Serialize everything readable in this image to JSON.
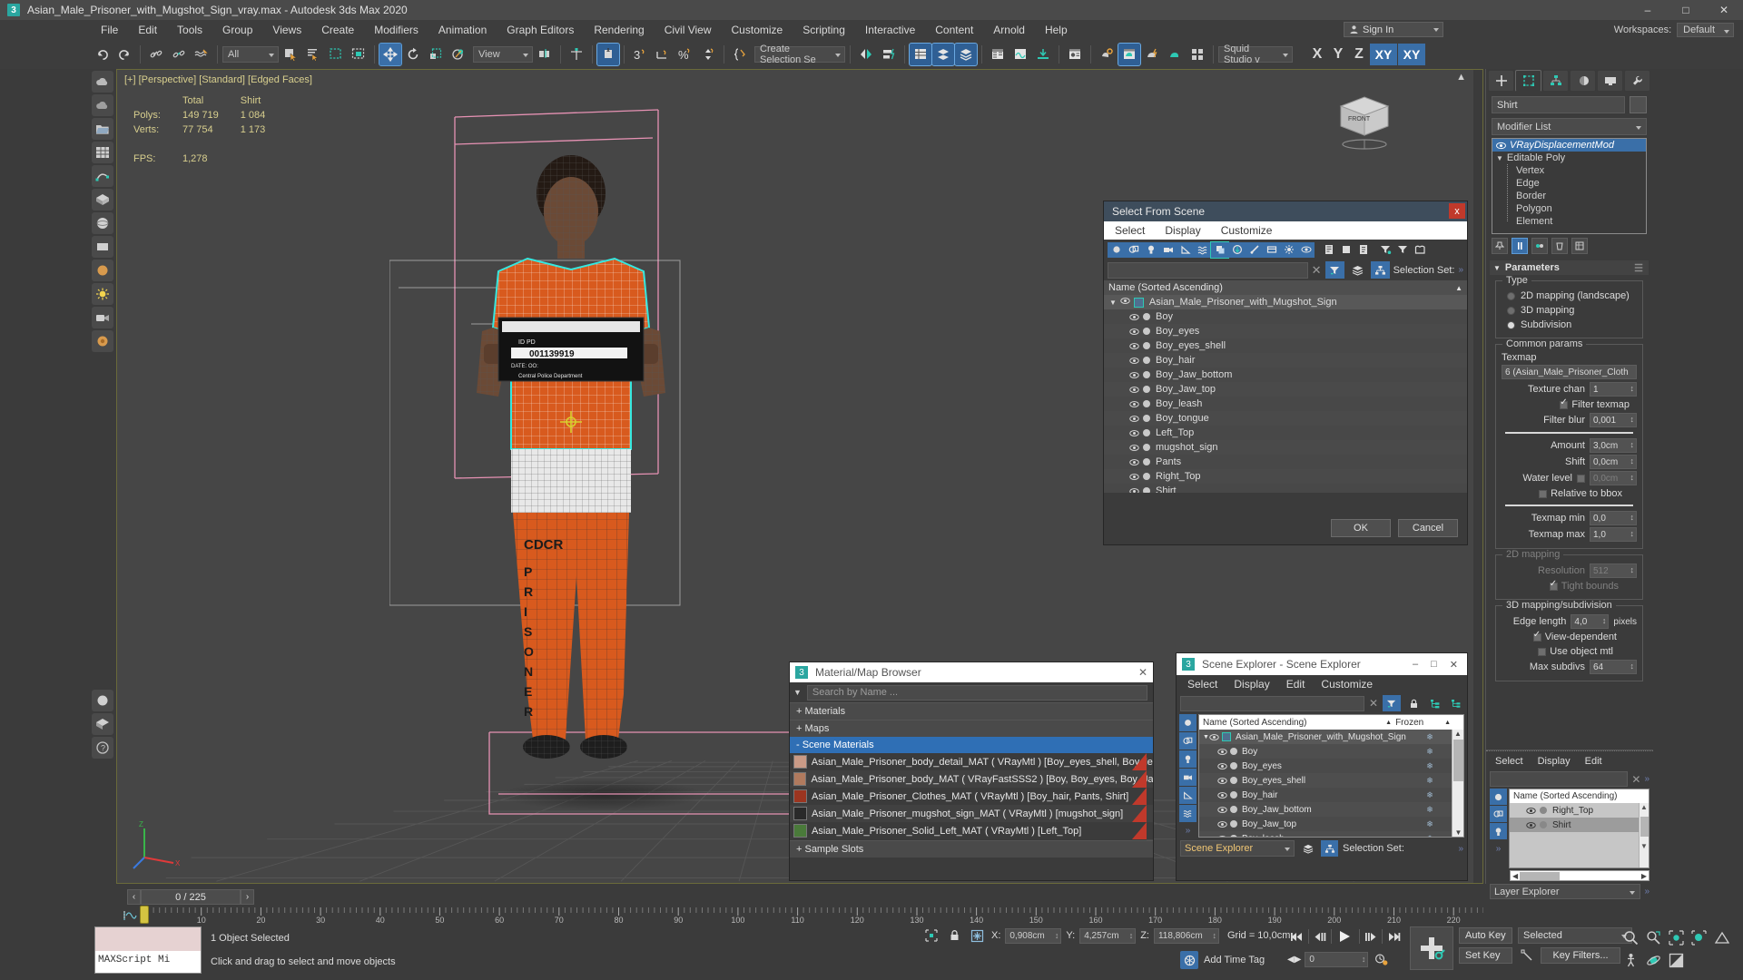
{
  "window": {
    "title": "Asian_Male_Prisoner_with_Mugshot_Sign_vray.max - Autodesk 3ds Max 2020",
    "app_badge": "3",
    "minimize": "–",
    "maximize": "□",
    "close": "✕"
  },
  "menubar": {
    "items": [
      "File",
      "Edit",
      "Tools",
      "Group",
      "Views",
      "Create",
      "Modifiers",
      "Animation",
      "Graph Editors",
      "Rendering",
      "Civil View",
      "Customize",
      "Scripting",
      "Interactive",
      "Content",
      "Arnold",
      "Help"
    ],
    "sign_in": "Sign In",
    "workspaces_label": "Workspaces:",
    "workspace_value": "Default"
  },
  "toolbar": {
    "selection_filter": "All",
    "reference_coord": "View",
    "named_selection_set": "Create Selection Se",
    "render_preset": "Squid Studio v",
    "axis_x": "X",
    "axis_y": "Y",
    "axis_z": "Z",
    "axis_xy": "XY",
    "axis_xyz": "XY"
  },
  "viewport": {
    "label": "[+] [Perspective] [Standard] [Edged Faces]",
    "stats": {
      "col_total": "Total",
      "col_obj": "Shirt",
      "polys_label": "Polys:",
      "polys_total": "149 719",
      "polys_obj": "1 084",
      "verts_label": "Verts:",
      "verts_total": "77 754",
      "verts_obj": "1 173",
      "fps_label": "FPS:",
      "fps_value": "1,278"
    },
    "viewcube_face": "FRONT",
    "sign_text": {
      "line1": "ID      PD",
      "line2": "001139919",
      "line3": "DATE:           OO:",
      "line4": "Central Police Department"
    },
    "pants_text": "CDCR PRISONER"
  },
  "command_panel": {
    "tabs": [
      "create-tab",
      "modify-tab",
      "hierarchy-tab",
      "motion-tab",
      "display-tab",
      "utilities-tab"
    ],
    "object_name": "Shirt",
    "modifier_list_label": "Modifier List",
    "stack": [
      {
        "label": "VRayDisplacementMod",
        "selected": true
      },
      {
        "label": "Editable Poly",
        "selected": false
      }
    ],
    "sub_objects": [
      "Vertex",
      "Edge",
      "Border",
      "Polygon",
      "Element"
    ],
    "rollout_title": "Parameters",
    "type_group": "Type",
    "type_options": [
      {
        "label": "2D mapping (landscape)",
        "on": false
      },
      {
        "label": "3D mapping",
        "on": false
      },
      {
        "label": "Subdivision",
        "on": true
      }
    ],
    "common_group": "Common params",
    "texmap_label": "Texmap",
    "texmap_value": "6 (Asian_Male_Prisoner_Cloth",
    "texture_chan_label": "Texture chan",
    "texture_chan_value": "1",
    "filter_texmap_label": "Filter texmap",
    "filter_texmap_on": true,
    "filter_blur_label": "Filter blur",
    "filter_blur_value": "0,001",
    "amount_label": "Amount",
    "amount_value": "3,0cm",
    "shift_label": "Shift",
    "shift_value": "0,0cm",
    "water_level_label": "Water level",
    "water_level_value": "0,0cm",
    "relative_bbox_label": "Relative to bbox",
    "texmap_min_label": "Texmap min",
    "texmap_min_value": "0,0",
    "texmap_max_label": "Texmap max",
    "texmap_max_value": "1,0",
    "mapping2d_group": "2D mapping",
    "resolution_label": "Resolution",
    "resolution_value": "512",
    "tight_bounds_label": "Tight bounds",
    "mapping3d_group": "3D mapping/subdivision",
    "edge_length_label": "Edge length",
    "edge_length_value": "4,0",
    "edge_length_unit": "pixels",
    "view_dependent_label": "View-dependent",
    "use_object_mtl_label": "Use object mtl",
    "max_subdivs_label": "Max subdivs",
    "max_subdivs_value": "64"
  },
  "layer_explorer": {
    "menu": [
      "Select",
      "Display",
      "Edit"
    ],
    "search_value": "",
    "column_header": "Name (Sorted Ascending)",
    "rows": [
      {
        "name": "Right_Top",
        "selected": false
      },
      {
        "name": "Shirt",
        "selected": true
      }
    ],
    "footer_dropdown": "Layer Explorer"
  },
  "select_from_scene": {
    "title": "Select From Scene",
    "close": "x",
    "menu": [
      "Select",
      "Display",
      "Customize"
    ],
    "search_value": "",
    "selection_set_label": "Selection Set:",
    "column_header": "Name (Sorted Ascending)",
    "root": "Asian_Male_Prisoner_with_Mugshot_Sign",
    "children": [
      "Boy",
      "Boy_eyes",
      "Boy_eyes_shell",
      "Boy_hair",
      "Boy_Jaw_bottom",
      "Boy_Jaw_top",
      "Boy_leash",
      "Boy_tongue",
      "Left_Top",
      "mugshot_sign",
      "Pants",
      "Right_Top",
      "Shirt"
    ],
    "ok_label": "OK",
    "cancel_label": "Cancel"
  },
  "material_browser": {
    "badge": "3",
    "title": "Material/Map Browser",
    "close": "✕",
    "search_placeholder": "Search by Name ...",
    "groups": [
      {
        "label": "+ Materials",
        "expanded": false,
        "selected": false
      },
      {
        "label": "+ Maps",
        "expanded": false,
        "selected": false
      },
      {
        "label": "- Scene Materials",
        "expanded": true,
        "selected": true
      }
    ],
    "materials": [
      {
        "name": "Asian_Male_Prisoner_body_detail_MAT",
        "type": "( VRayMtl )",
        "objects": "[Boy_eyes_shell, Boy_le...",
        "swatch": "#c99a86"
      },
      {
        "name": "Asian_Male_Prisoner_body_MAT",
        "type": "( VRayFastSSS2 )",
        "objects": "[Boy, Boy_eyes, Boy_Jaw...",
        "swatch": "#b07a5e"
      },
      {
        "name": "Asian_Male_Prisoner_Clothes_MAT",
        "type": "( VRayMtl )",
        "objects": "[Boy_hair, Pants, Shirt]",
        "swatch": "#9c3520"
      },
      {
        "name": "Asian_Male_Prisoner_mugshot_sign_MAT",
        "type": "( VRayMtl )",
        "objects": "[mugshot_sign]",
        "swatch": "#2a2a2a"
      },
      {
        "name": "Asian_Male_Prisoner_Solid_Left_MAT",
        "type": "( VRayMtl )",
        "objects": "[Left_Top]",
        "swatch": "#4a7a3a"
      }
    ],
    "footer_group": "+ Sample Slots"
  },
  "scene_explorer": {
    "badge": "3",
    "title": "Scene Explorer - Scene Explorer",
    "minimize": "–",
    "maximize": "□",
    "close": "✕",
    "menu": [
      "Select",
      "Display",
      "Edit",
      "Customize"
    ],
    "search_value": "",
    "col_name": "Name (Sorted Ascending)",
    "col_frozen": "Frozen",
    "root": "Asian_Male_Prisoner_with_Mugshot_Sign",
    "children": [
      "Boy",
      "Boy_eyes",
      "Boy_eyes_shell",
      "Boy_hair",
      "Boy_Jaw_bottom",
      "Boy_Jaw_top",
      "Boy_leash"
    ],
    "footer_dropdown": "Scene Explorer",
    "selection_set_label": "Selection Set:"
  },
  "trackbar": {
    "frame_display": "0 / 225",
    "prev_arrow": "‹",
    "next_arrow": "›",
    "ticks": [
      "10",
      "20",
      "30",
      "40",
      "50",
      "60",
      "70",
      "80",
      "90",
      "100",
      "110",
      "120",
      "130",
      "140",
      "150",
      "160",
      "170",
      "180",
      "190",
      "200",
      "210",
      "220"
    ]
  },
  "statusbar": {
    "maxscript_label": "MAXScript Mi",
    "selection_status": "1 Object Selected",
    "prompt": "Click and drag to select and move objects",
    "x_label": "X:",
    "x_value": "0,908cm",
    "y_label": "Y:",
    "y_value": "4,257cm",
    "z_label": "Z:",
    "z_value": "118,806cm",
    "grid_label": "Grid = 10,0cm",
    "add_time_tag": "Add Time Tag",
    "auto_key": "Auto Key",
    "set_key": "Set Key",
    "key_mode": "Selected",
    "key_filters": "Key Filters...",
    "current_frame": "0"
  },
  "colors": {
    "accent_blue": "#3a6fa8",
    "teal": "#2ec9b4",
    "orange": "#d85a1e",
    "yellow_label": "#d8cf8e",
    "panel_bg": "#3b3b3b",
    "red_close": "#c0392b"
  }
}
